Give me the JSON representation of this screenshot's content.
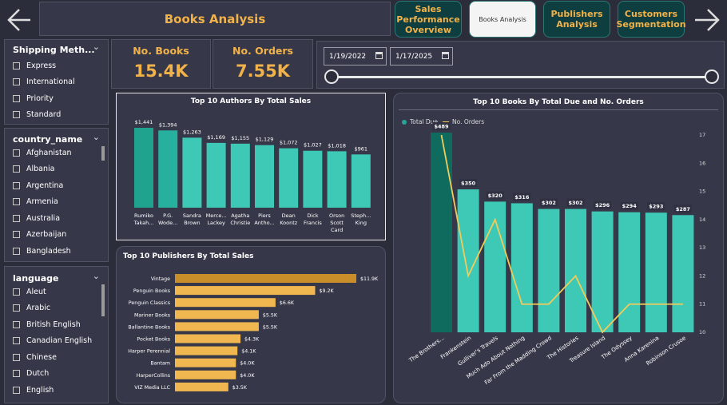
{
  "header": {
    "title": "Books Analysis"
  },
  "nav": {
    "sales": "Sales Performance Overview",
    "books": "Books Analysis",
    "publishers": "Publishers Analysis",
    "customers": "Customers Segmentation"
  },
  "kpis": {
    "books_label": "No. Books",
    "books_value": "15.4K",
    "orders_label": "No. Orders",
    "orders_value": "7.55K"
  },
  "date_range": {
    "start": "1/19/2022",
    "end": "1/17/2025"
  },
  "slicers": {
    "shipping": {
      "title": "Shipping Meth...",
      "items": [
        "Express",
        "International",
        "Priority",
        "Standard"
      ]
    },
    "country": {
      "title": "country_name",
      "items": [
        "Afghanistan",
        "Albania",
        "Argentina",
        "Armenia",
        "Australia",
        "Azerbaijan",
        "Bangladesh"
      ]
    },
    "language": {
      "title": "language",
      "items": [
        "Aleut",
        "Arabic",
        "British English",
        "Canadian English",
        "Chinese",
        "Dutch",
        "English"
      ]
    }
  },
  "colors": {
    "teal": "#3ec8b6",
    "dark_teal": "#0f6b5e",
    "gold": "#e8a838",
    "line": "#f2cc5a"
  },
  "chart_data": [
    {
      "type": "bar",
      "title": "Top 10 Authors By Total Sales",
      "categories": [
        "Rumiko Takah...",
        "P.G. Wode...",
        "Sandra Brown",
        "Merce... Lackey",
        "Agatha Christie",
        "Piers Antho...",
        "Dean Koontz",
        "Dick Francis",
        "Orson Scott Card",
        "Steph... King"
      ],
      "values": [
        1441,
        1394,
        1263,
        1169,
        1155,
        1129,
        1072,
        1027,
        1018,
        961
      ],
      "labels": [
        "$1,441",
        "$1,394",
        "$1,263",
        "$1,169",
        "$1,155",
        "$1,129",
        "$1,072",
        "$1,027",
        "$1,018",
        "$961"
      ]
    },
    {
      "type": "bar",
      "orientation": "horizontal",
      "title": "Top 10 Publishers By Total Sales",
      "categories": [
        "Vintage",
        "Penguin Books",
        "Penguin Classics",
        "Mariner Books",
        "Ballantine Books",
        "Pocket Books",
        "Harper Perennial",
        "Bantam",
        "HarperCollins",
        "VIZ Media LLC"
      ],
      "values": [
        11.9,
        9.2,
        6.6,
        5.5,
        5.5,
        4.3,
        4.1,
        4.0,
        4.0,
        3.5
      ],
      "labels": [
        "$11.9K",
        "$9.2K",
        "$6.6K",
        "$5.5K",
        "$5.5K",
        "$4.3K",
        "$4.1K",
        "$4.0K",
        "$4.0K",
        "$3.5K"
      ]
    },
    {
      "type": "bar+line",
      "title": "Top 10 Books By Total Due and No. Orders",
      "legend": [
        "Total Due",
        "No. Orders"
      ],
      "categories": [
        "The Brothers...",
        "Frankenstein",
        "Gulliver's Travels",
        "Much Ado About Nothing",
        "Far From the Madding Crowd",
        "The Histories",
        "Treasure Island",
        "The Odyssey",
        "Anna Karenina",
        "Robinson Crusoe"
      ],
      "bar_values": [
        489,
        350,
        320,
        316,
        302,
        302,
        296,
        294,
        293,
        287
      ],
      "bar_labels": [
        "$489",
        "$350",
        "$320",
        "$316",
        "$302",
        "$302",
        "$296",
        "$294",
        "$293",
        "$287"
      ],
      "line_values": [
        17,
        12,
        14,
        11,
        11,
        12,
        10,
        11,
        11,
        11
      ],
      "y2_ticks": [
        "17",
        "16",
        "15",
        "14",
        "13",
        "12",
        "11",
        "10"
      ],
      "y2lim": [
        10,
        17
      ]
    }
  ]
}
